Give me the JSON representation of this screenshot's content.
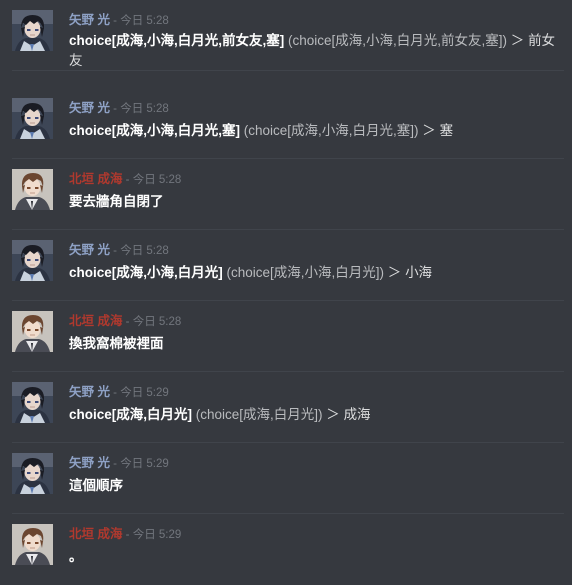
{
  "channel": {
    "messages": [
      {
        "author": "矢野 光",
        "sep": " - ",
        "time": "今日 5:28",
        "command": "choice[成海,小海,白月光,前女友,塞]",
        "echo": " (choice[成海,小海,白月光,前女友,塞])",
        "arrow": " ＞ ",
        "result": "前女友"
      },
      {
        "author": "矢野 光",
        "sep": " - ",
        "time": "今日 5:28",
        "command": "choice[成海,小海,白月光,塞]",
        "echo": " (choice[成海,小海,白月光,塞])",
        "arrow": " ＞ ",
        "result": "塞"
      },
      {
        "author": "北垣 成海",
        "sep": " - ",
        "time": "今日 5:28",
        "text": "要去牆角自閉了"
      },
      {
        "author": "矢野 光",
        "sep": " - ",
        "time": "今日 5:28",
        "command": "choice[成海,小海,白月光]",
        "echo": " (choice[成海,小海,白月光])",
        "arrow": " ＞ ",
        "result": "小海"
      },
      {
        "author": "北垣 成海",
        "sep": " - ",
        "time": "今日 5:28",
        "text": "換我窩棉被裡面"
      },
      {
        "author": "矢野 光",
        "sep": " - ",
        "time": "今日 5:29",
        "command": "choice[成海,白月光]",
        "echo": " (choice[成海,白月光])",
        "arrow": " ＞ ",
        "result": "成海"
      },
      {
        "author": "矢野 光",
        "sep": " - ",
        "time": "今日 5:29",
        "text": "這個順序"
      },
      {
        "author": "北垣 成海",
        "sep": " - ",
        "time": "今日 5:29",
        "text": "。"
      }
    ]
  },
  "colors": {
    "background": "#36393f",
    "author_yano": "#8ea1c5",
    "author_kitagaki": "#b0392e",
    "timestamp": "#72767d"
  },
  "icons": {
    "avatar_yano": "dark-haired-anime-boy-avatar",
    "avatar_kitagaki": "brown-haired-anime-boy-avatar"
  }
}
